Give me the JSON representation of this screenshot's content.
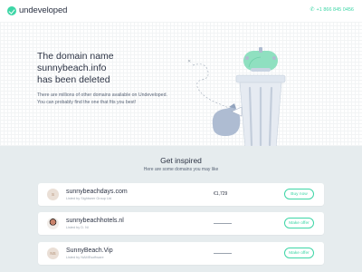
{
  "header": {
    "logo_text": "undeveloped",
    "phone": "+1 866 845 0456",
    "phone_icon": "phone-icon"
  },
  "hero": {
    "headline_line1": "The domain name",
    "headline_line2": "sunnybeach.info",
    "headline_line3": "has been deleted",
    "sub_line1": "There are millions of other domains available on Undeveloped.",
    "sub_line2": "You can probably find the one that fits you best!"
  },
  "inspired": {
    "title": "Get inspired",
    "subtitle": "Here are some domains you may like",
    "items": [
      {
        "domain": "sunnybeachdays.com",
        "listed_by": "Listed by Sightseer Group Ltd",
        "price": "€1,729",
        "has_price": true,
        "action": "Buy now",
        "avatar": "initial",
        "avatar_text": "S"
      },
      {
        "domain": "sunnybeachhotels.nl",
        "listed_by": "Listed by D. Nl",
        "price": "",
        "has_price": false,
        "action": "Make offer",
        "avatar": "photo",
        "avatar_text": ""
      },
      {
        "domain": "SunnyBeach.Vip",
        "listed_by": "Listed by NAMEsoftware",
        "price": "",
        "has_price": false,
        "action": "Make offer",
        "avatar": "initial",
        "avatar_text": "NS"
      }
    ]
  },
  "colors": {
    "accent": "#3dd6a6",
    "text": "#2c3344",
    "section_bg": "#e6ecee"
  }
}
